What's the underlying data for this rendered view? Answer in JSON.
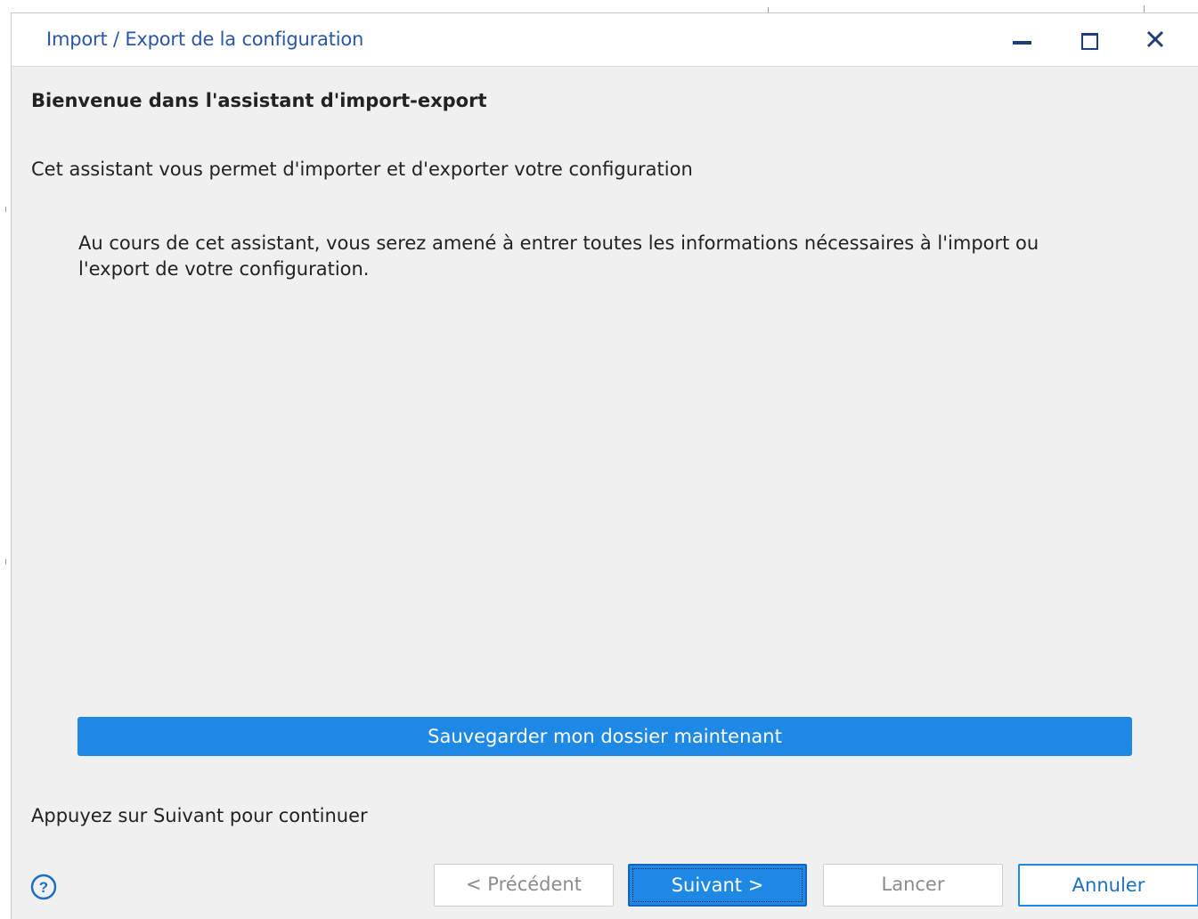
{
  "window": {
    "title": "Import / Export de la configuration"
  },
  "content": {
    "heading": "Bienvenue dans l'assistant d'import-export",
    "intro": "Cet assistant vous permet d'importer et d'exporter votre configuration",
    "description": "Au cours de cet assistant, vous serez amené à entrer toutes les informations nécessaires à l'import ou l'export de votre configuration.",
    "save_button_label": "Sauvegarder mon dossier maintenant",
    "hint": "Appuyez sur Suivant pour continuer"
  },
  "footer": {
    "help_icon": "question-circle-icon",
    "previous_label": "< Précédent",
    "next_label": "Suivant >",
    "launch_label": "Lancer",
    "cancel_label": "Annuler"
  },
  "colors": {
    "accent": "#1e88e5",
    "title_text": "#2a56a4",
    "disabled_text": "#8c8c8c",
    "dialog_background": "#f0f0f0"
  }
}
